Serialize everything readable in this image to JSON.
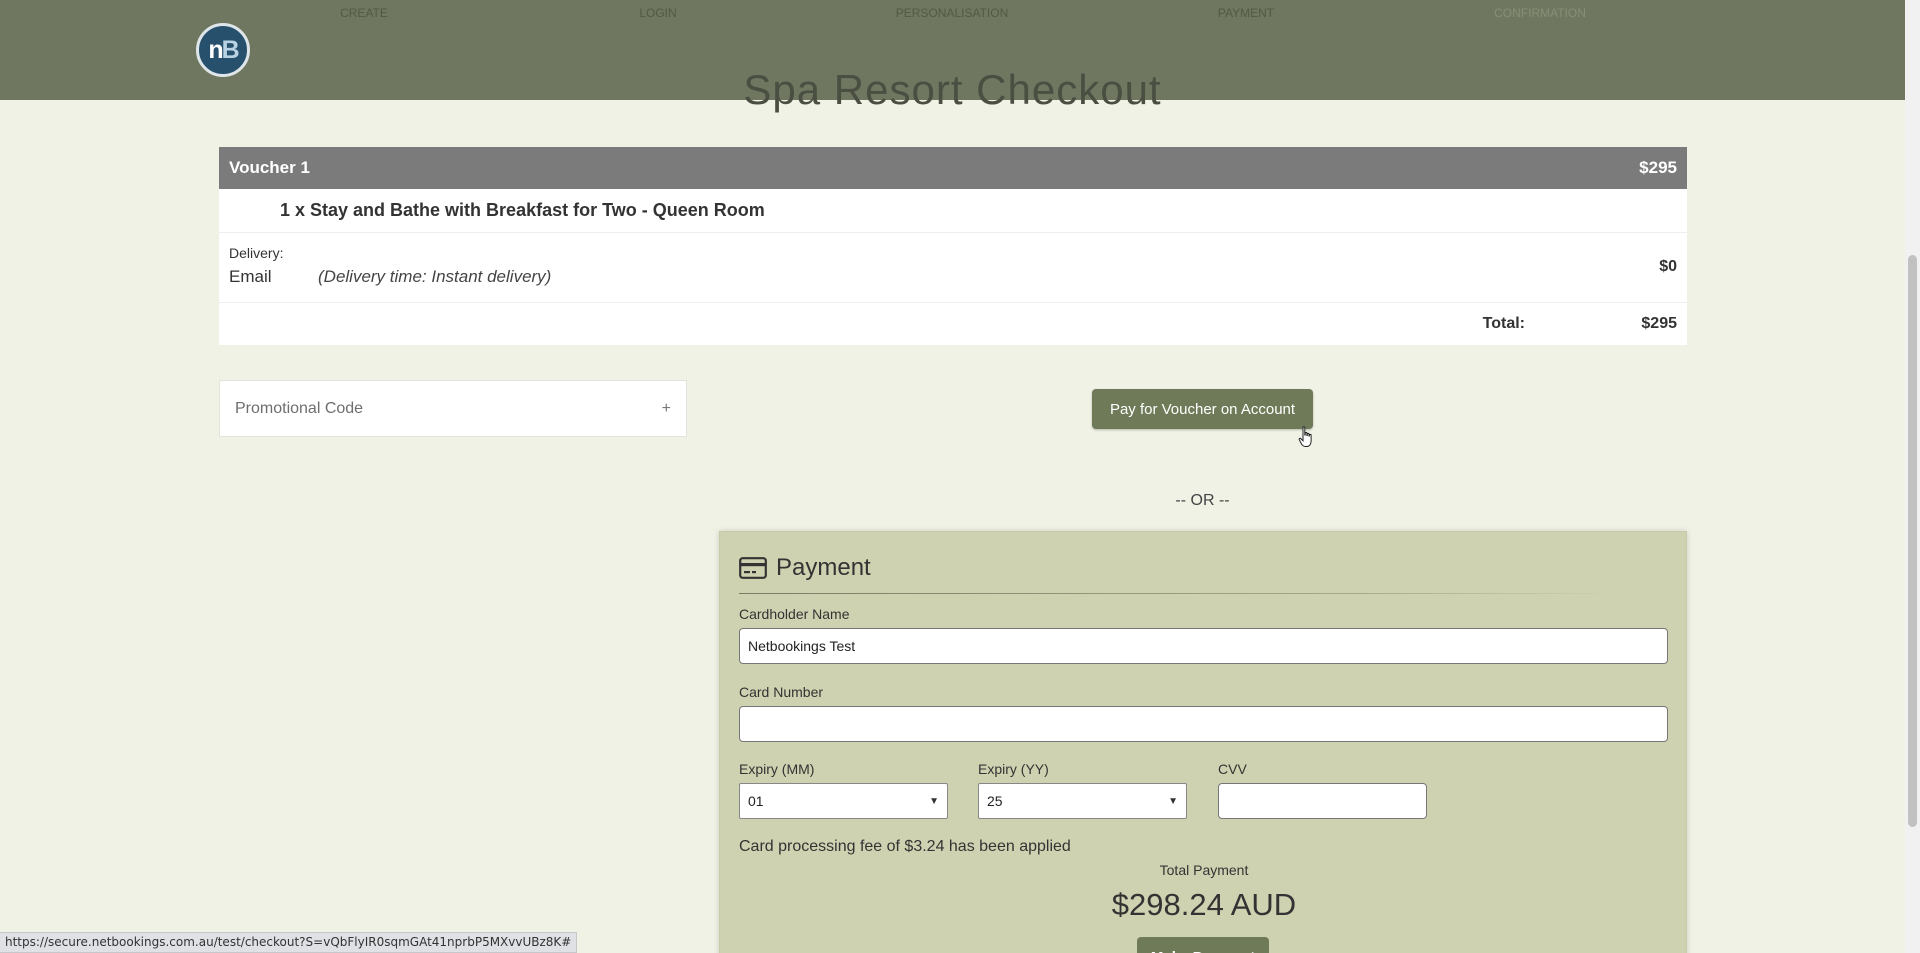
{
  "steps": [
    "CREATE",
    "LOGIN",
    "PERSONALISATION",
    "PAYMENT",
    "CONFIRMATION"
  ],
  "brand": {
    "logo_text_left": "n",
    "logo_text_right": "B"
  },
  "page_title": "Spa Resort Checkout",
  "order": {
    "voucher_label": "Voucher 1",
    "voucher_price": "$295",
    "item": "1 x Stay and Bathe with Breakfast for Two - Queen Room",
    "delivery_label": "Delivery:",
    "delivery_method": "Email",
    "delivery_time": "(Delivery time: Instant delivery)",
    "delivery_price": "$0",
    "total_label": "Total:",
    "total_value": "$295"
  },
  "promo": {
    "label": "Promotional Code",
    "toggle": "+"
  },
  "account_button": "Pay for Voucher on Account",
  "or_text": "-- OR --",
  "payment": {
    "title": "Payment",
    "cardholder_label": "Cardholder Name",
    "cardholder_value": "Netbookings Test",
    "card_number_label": "Card Number",
    "card_number_value": "",
    "expiry_mm_label": "Expiry (MM)",
    "expiry_mm_value": "01",
    "expiry_yy_label": "Expiry (YY)",
    "expiry_yy_value": "25",
    "cvv_label": "CVV",
    "cvv_value": "",
    "fee_text": "Card processing fee of $3.24 has been applied",
    "total_label": "Total Payment",
    "total_value": "$298.24 AUD",
    "make_payment_button": "Make Payment"
  },
  "status_url": "https://secure.netbookings.com.au/test/checkout?S=vQbFlyIR0sqmGAt41nprbP5MXvvUBz8K#"
}
